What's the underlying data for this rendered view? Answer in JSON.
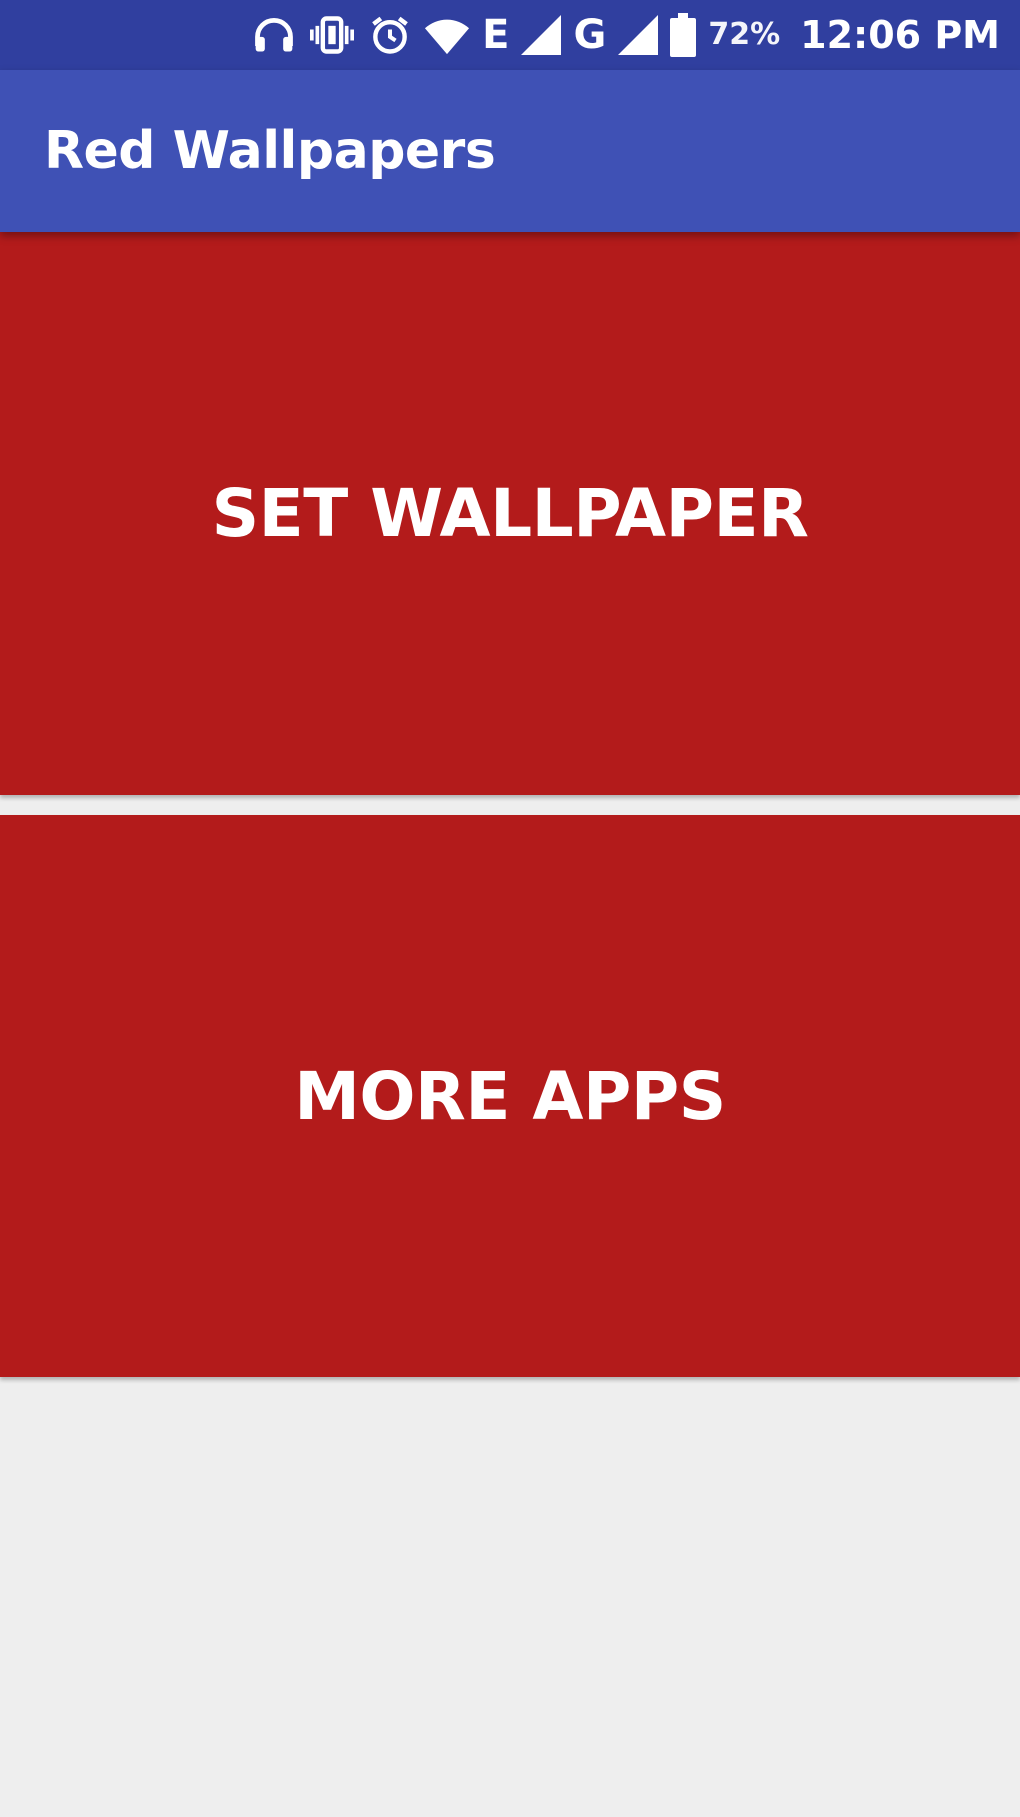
{
  "status_bar": {
    "network_type_1": "E",
    "network_type_2": "G",
    "battery_percent": "72%",
    "time": "12:06 PM",
    "icons": [
      "headphones-icon",
      "vibrate-icon",
      "alarm-icon",
      "wifi-icon",
      "signal-icon",
      "signal-icon",
      "battery-icon"
    ]
  },
  "app_bar": {
    "title": "Red Wallpapers"
  },
  "buttons": {
    "set_wallpaper": "SET WALLPAPER",
    "more_apps": "MORE APPS"
  },
  "colors": {
    "status_bar": "#303f9f",
    "app_bar": "#3f51b5",
    "button_red": "#b31b1b",
    "background": "#eeeeee"
  }
}
